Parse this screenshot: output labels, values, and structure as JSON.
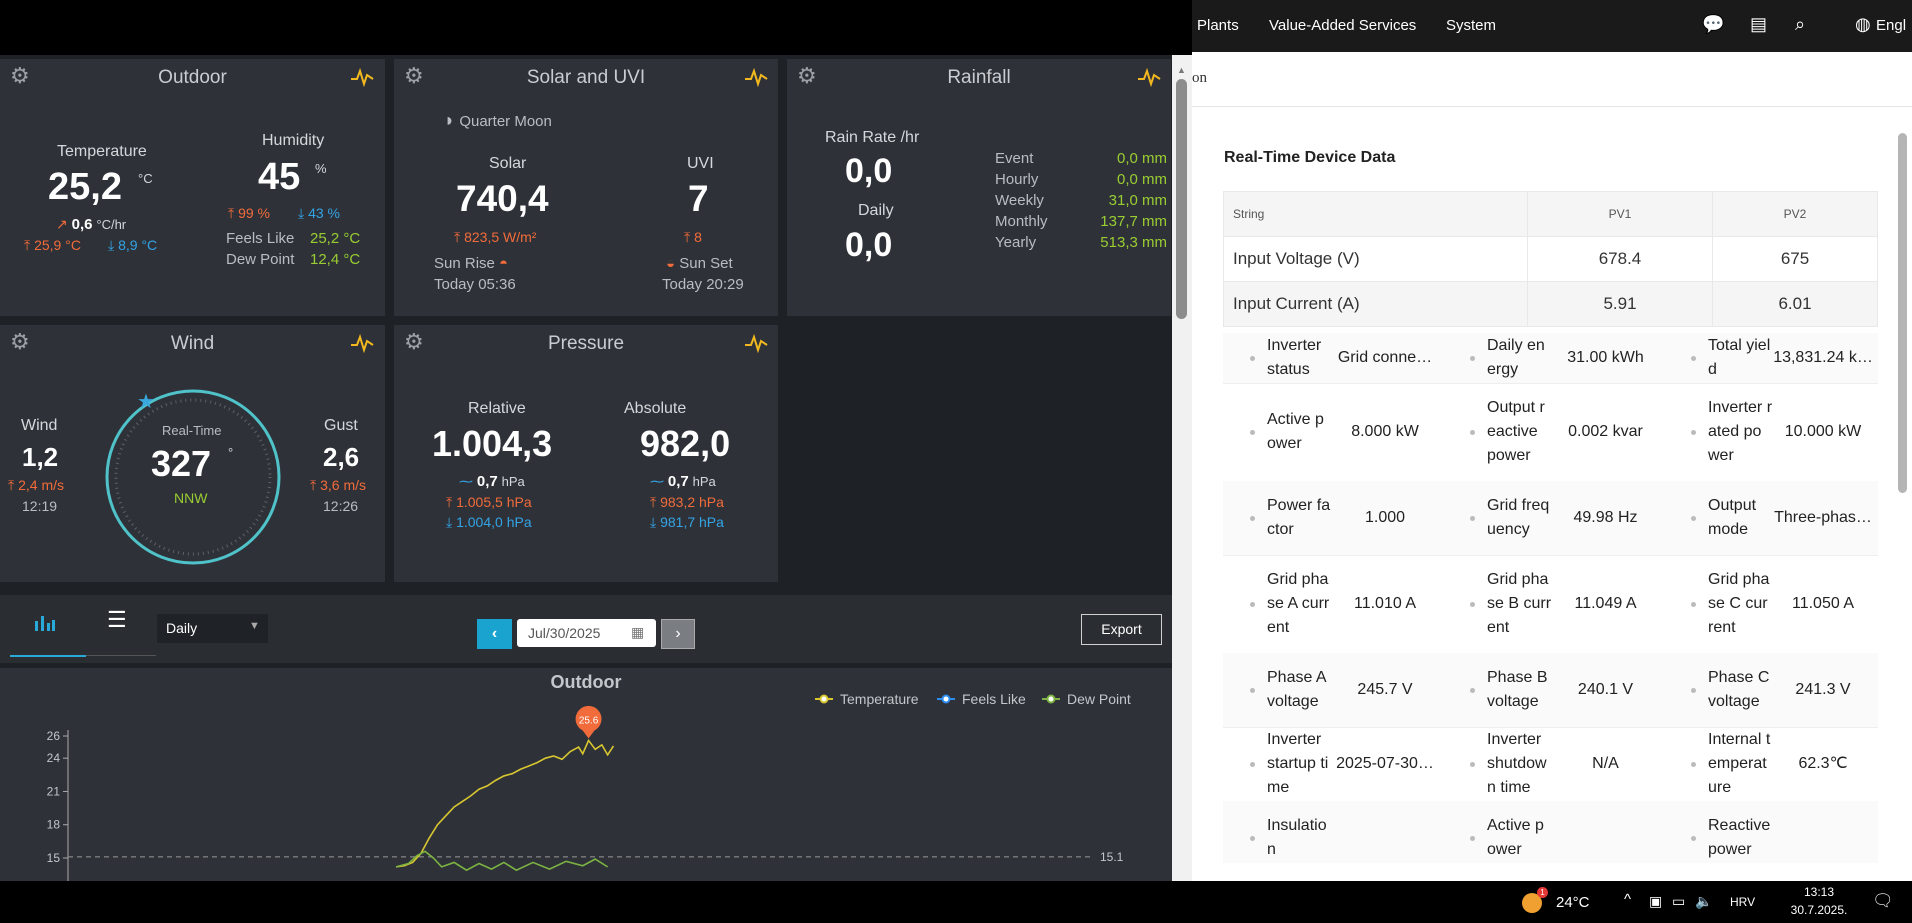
{
  "outdoor": {
    "title": "Outdoor",
    "temperature_label": "Temperature",
    "temperature": "25,2",
    "temperature_unit": "°C",
    "rate": "0,6",
    "rate_unit": "°C/hr",
    "temp_high": "25,9 °C",
    "temp_low": "8,9 °C",
    "humidity_label": "Humidity",
    "humidity": "45",
    "humidity_unit": "%",
    "hum_high": "99 %",
    "hum_low": "43 %",
    "feels_like_label": "Feels Like",
    "feels_like": "25,2 °C",
    "dew_point_label": "Dew Point",
    "dew_point": "12,4 °C"
  },
  "solar_uvi": {
    "title": "Solar and UVI",
    "moon": "Quarter Moon",
    "solar_label": "Solar",
    "solar": "740,4",
    "solar_max": "823,5 W/m²",
    "uvi_label": "UVI",
    "uvi": "7",
    "uvi_max": "8",
    "sunrise_label": "Sun Rise",
    "sunrise_time": "Today 05:36",
    "sunset_label": "Sun Set",
    "sunset_time": "Today 20:29"
  },
  "rainfall": {
    "title": "Rainfall",
    "rate_label": "Rain Rate /hr",
    "rate": "0,0",
    "daily_label": "Daily",
    "daily": "0,0",
    "rows": [
      {
        "label": "Event",
        "value": "0,0 mm"
      },
      {
        "label": "Hourly",
        "value": "0,0 mm"
      },
      {
        "label": "Weekly",
        "value": "31,0 mm"
      },
      {
        "label": "Monthly",
        "value": "137,7 mm"
      },
      {
        "label": "Yearly",
        "value": "513,3 mm"
      }
    ]
  },
  "wind": {
    "title": "Wind",
    "wind_label": "Wind",
    "wind": "1,2",
    "wind_max": "2,4 m/s",
    "wind_time": "12:19",
    "realtime_label": "Real-Time",
    "direction": "327",
    "direction_unit": "°",
    "direction_name": "NNW",
    "gust_label": "Gust",
    "gust": "2,6",
    "gust_max": "3,6 m/s",
    "gust_time": "12:26"
  },
  "pressure": {
    "title": "Pressure",
    "relative_label": "Relative",
    "relative": "1.004,3",
    "rel_trend": "0,7",
    "rel_high": "1.005,5 hPa",
    "rel_low": "1.004,0 hPa",
    "absolute_label": "Absolute",
    "absolute": "982,0",
    "abs_trend": "0,7",
    "abs_high": "983,2 hPa",
    "abs_low": "981,7 hPa",
    "unit": "hPa"
  },
  "toolbar": {
    "period": "Daily",
    "date": "Jul/30/2025",
    "export_label": "Export"
  },
  "chart_data": {
    "type": "line",
    "title": "Outdoor",
    "series": [
      {
        "name": "Temperature",
        "color": "#d8c630"
      },
      {
        "name": "Feels Like",
        "color": "#2d8cf0"
      },
      {
        "name": "Dew Point",
        "color": "#7cb342"
      }
    ],
    "y_ticks": [
      "26",
      "24",
      "21",
      "18",
      "15"
    ],
    "ref_line": "15.1",
    "max_marker": "25.6",
    "temperature_points": [
      [
        0,
        14.2
      ],
      [
        10,
        14.3
      ],
      [
        20,
        14.6
      ],
      [
        30,
        15.4
      ],
      [
        40,
        16.8
      ],
      [
        50,
        18.0
      ],
      [
        60,
        18.8
      ],
      [
        70,
        19.6
      ],
      [
        80,
        20.1
      ],
      [
        90,
        20.6
      ],
      [
        100,
        21.2
      ],
      [
        110,
        21.5
      ],
      [
        120,
        22.0
      ],
      [
        130,
        22.4
      ],
      [
        140,
        22.6
      ],
      [
        150,
        23.0
      ],
      [
        160,
        23.3
      ],
      [
        170,
        23.6
      ],
      [
        180,
        24.0
      ],
      [
        190,
        24.2
      ],
      [
        200,
        23.9
      ],
      [
        210,
        24.6
      ],
      [
        220,
        25.0
      ],
      [
        225,
        24.4
      ],
      [
        232,
        25.6
      ],
      [
        240,
        24.8
      ],
      [
        248,
        25.2
      ],
      [
        255,
        24.3
      ],
      [
        262,
        25.1
      ]
    ],
    "dew_points": [
      [
        0,
        14.2
      ],
      [
        15,
        14.5
      ],
      [
        25,
        15.2
      ],
      [
        35,
        15.6
      ],
      [
        45,
        15.0
      ],
      [
        55,
        14.2
      ],
      [
        70,
        14.6
      ],
      [
        85,
        13.9
      ],
      [
        100,
        14.5
      ],
      [
        115,
        14.0
      ],
      [
        130,
        14.6
      ],
      [
        145,
        13.9
      ],
      [
        165,
        14.6
      ],
      [
        185,
        14.0
      ],
      [
        205,
        14.7
      ],
      [
        225,
        14.3
      ],
      [
        240,
        14.9
      ],
      [
        255,
        14.2
      ]
    ]
  },
  "solar_app": {
    "nav": [
      "Plants",
      "Value-Added Services",
      "System"
    ],
    "nav_lang": "Engl",
    "crumb": "on",
    "section_title": "Real-Time Device Data",
    "table_header": [
      "String",
      "PV1",
      "PV2"
    ],
    "table_rows": [
      [
        "Input Voltage (V)",
        "678.4",
        "675"
      ],
      [
        "Input Current (A)",
        "5.91",
        "6.01"
      ]
    ],
    "grid": [
      [
        [
          "Inverter status",
          "Grid conne…"
        ],
        [
          "Daily energy",
          "31.00 kWh"
        ],
        [
          "Total yield",
          "13,831.24 k…"
        ]
      ],
      [
        [
          "Active power",
          "8.000 kW"
        ],
        [
          "Output reactive power",
          "0.002 kvar"
        ],
        [
          "Inverter rated power",
          "10.000 kW"
        ]
      ],
      [
        [
          "Power factor",
          "1.000"
        ],
        [
          "Grid frequency",
          "49.98 Hz"
        ],
        [
          "Output mode",
          "Three-phas…"
        ]
      ],
      [
        [
          "Grid phase A current",
          "11.010 A"
        ],
        [
          "Grid phase B current",
          "11.049 A"
        ],
        [
          "Grid phase C current",
          "11.050 A"
        ]
      ],
      [
        [
          "Phase A voltage",
          "245.7 V"
        ],
        [
          "Phase B voltage",
          "240.1 V"
        ],
        [
          "Phase C voltage",
          "241.3 V"
        ]
      ],
      [
        [
          "Inverter startup time",
          "2025-07-30…"
        ],
        [
          "Inverter shutdown time",
          "N/A"
        ],
        [
          "Internal temperature",
          "62.3℃"
        ]
      ],
      [
        [
          "Insulation",
          ""
        ],
        [
          "Active power",
          ""
        ],
        [
          "Reactive power",
          ""
        ]
      ]
    ]
  },
  "taskbar": {
    "badge": "1",
    "weather": "24°C",
    "lang": "HRV",
    "time": "13:13",
    "date": "30.7.2025."
  }
}
